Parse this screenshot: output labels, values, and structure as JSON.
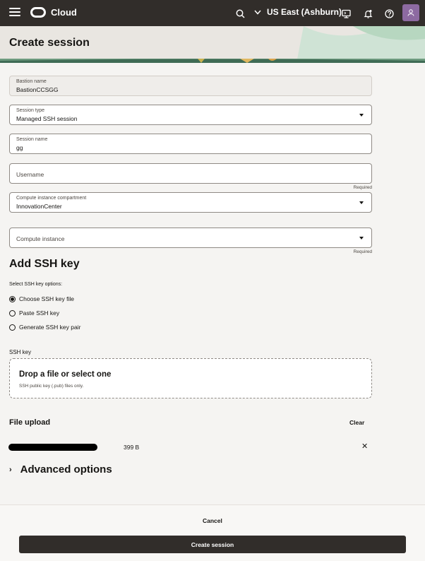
{
  "nav": {
    "brand": "Cloud",
    "region": "US East (Ashburn)"
  },
  "header": {
    "title": "Create session"
  },
  "form": {
    "bastion_name": {
      "label": "Bastion name",
      "value": "BastionCCSGG"
    },
    "session_type": {
      "label": "Session type",
      "value": "Managed SSH session"
    },
    "session_name": {
      "label": "Session name",
      "value": "gg"
    },
    "username": {
      "placeholder": "Username",
      "required": "Required"
    },
    "compartment": {
      "label": "Compute instance compartment",
      "value": "InnovationCenter"
    },
    "compute_instance": {
      "placeholder": "Compute instance",
      "required": "Required"
    }
  },
  "ssh": {
    "section_title": "Add SSH key",
    "options_label": "Select SSH key options:",
    "options": [
      {
        "label": "Choose SSH key file",
        "selected": true
      },
      {
        "label": "Paste SSH key",
        "selected": false
      },
      {
        "label": "Generate SSH key pair",
        "selected": false
      }
    ],
    "key_label": "SSH key",
    "dropzone_title": "Drop a file or select one",
    "dropzone_subtitle": "SSH public key (.pub) files only."
  },
  "upload": {
    "title": "File upload",
    "clear": "Clear",
    "file_size": "399 B"
  },
  "advanced": {
    "label": "Advanced options"
  },
  "footer": {
    "cancel": "Cancel",
    "create": "Create session"
  },
  "colors": {
    "nav_bg": "#312d2a",
    "avatar": "#8d6aa1",
    "primary_button": "#312d2a"
  }
}
